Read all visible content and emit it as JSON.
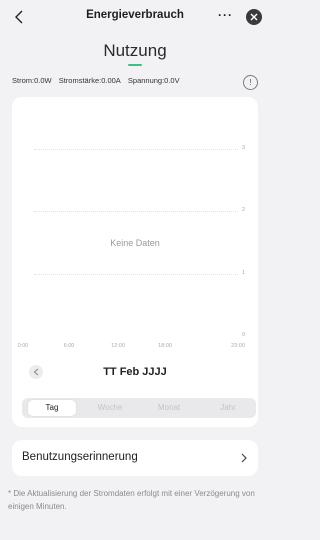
{
  "header": {
    "title": "Energieverbrauch",
    "more_label": "···",
    "back_icon": "chevron-left-icon",
    "close_icon": "close-icon"
  },
  "page": {
    "title": "Nutzung",
    "accent_color": "#3cbf8a"
  },
  "metrics": {
    "power": "Strom:0.0W",
    "current": "Stromstärke:0.00A",
    "voltage": "Spannung:0.0V",
    "info_icon": "info-icon"
  },
  "chart_data": {
    "type": "bar",
    "x_ticks": [
      "0:00",
      "6:00",
      "12:00",
      "18:00",
      "23:00"
    ],
    "y_ticks": [
      "0",
      "1",
      "2",
      "3"
    ],
    "ylim": [
      0,
      3
    ],
    "values": [],
    "empty_label": "Keine Daten",
    "grid": true
  },
  "date_nav": {
    "date_label": "TT Feb JJJJ",
    "prev_icon": "chevron-left-icon"
  },
  "period_tabs": {
    "items": [
      "Tag",
      "Woche",
      "Monat",
      "Jahr"
    ],
    "selected": "Tag"
  },
  "reminder": {
    "label": "Benutzungserinnerung",
    "chevron_icon": "chevron-right-icon"
  },
  "footnote": "* Die Aktualisierung der Stromdaten erfolgt mit einer Verzögerung von einigen Minuten."
}
